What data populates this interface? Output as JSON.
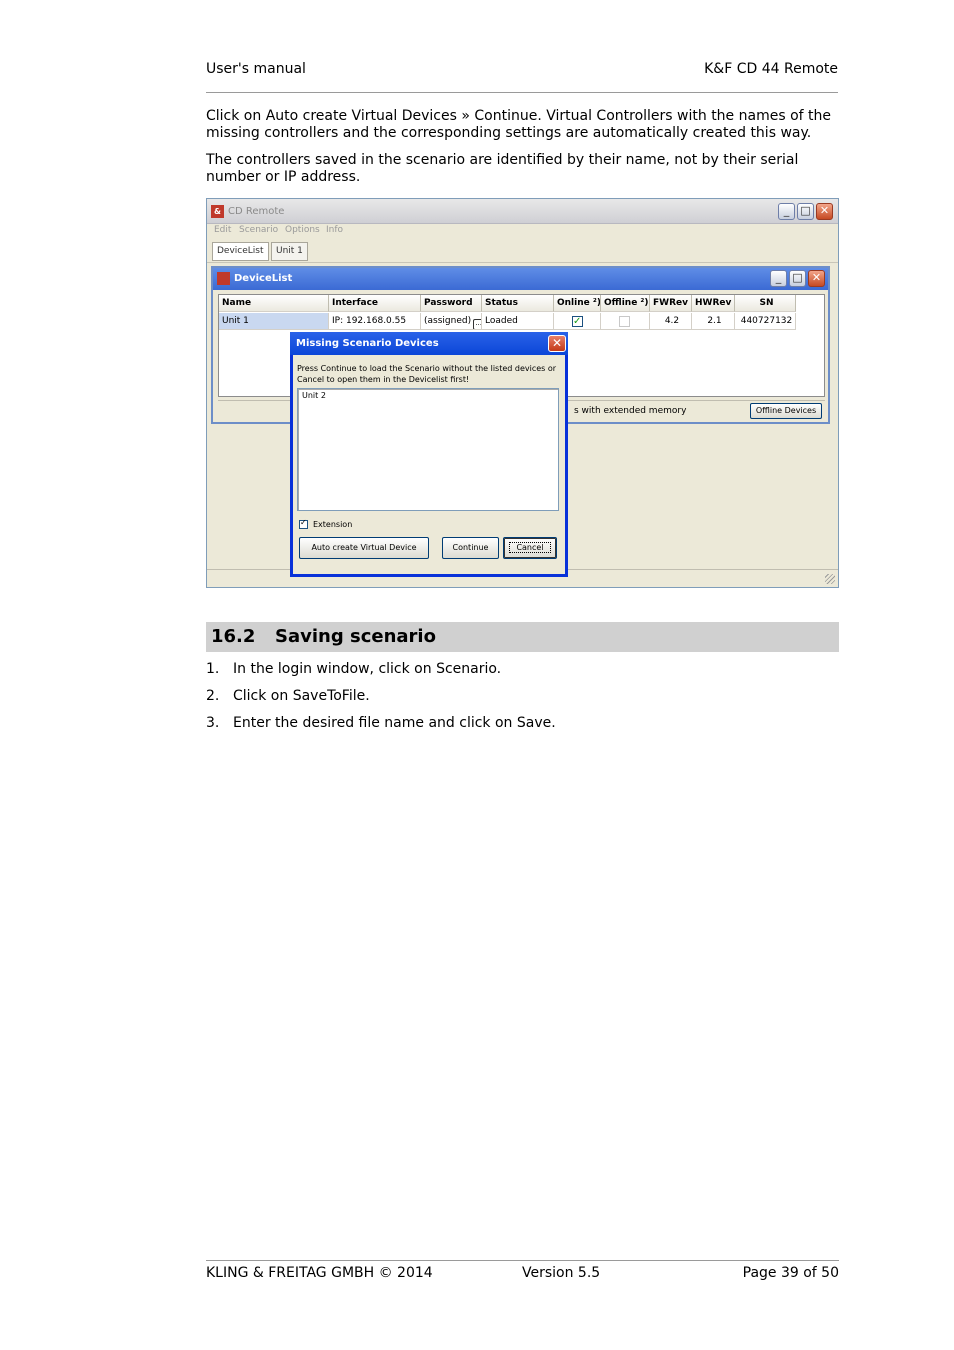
{
  "header": {
    "left": "User's manual",
    "right": "K&F CD  44 Remote"
  },
  "intro": {
    "p1": "Click on Auto create Virtual Devices » Continue. Virtual Controllers with the names of the missing controllers and the corresponding settings are automatically created this way.",
    "p2": "The controllers saved in the scenario are identified by their name, not by their serial number or IP address."
  },
  "app": {
    "app_icon": "&",
    "title": "CD Remote",
    "menu": [
      "Edit",
      "Scenario",
      "Options",
      "Info"
    ],
    "tabs": [
      "DeviceList",
      "Unit 1"
    ],
    "devicelist": {
      "title": "DeviceList",
      "columns": [
        "Name",
        "Interface",
        "Password",
        "Status",
        "Online ²)",
        "Offline ²)",
        "FWRev",
        "HWRev",
        "SN"
      ],
      "row": {
        "name": "Unit 1",
        "interface": "IP: 192.168.0.55",
        "password": "(assigned)",
        "password_btn": "...",
        "status": "Loaded",
        "online": true,
        "offline": false,
        "fwrev": "4.2",
        "hwrev": "2.1",
        "sn": "440727132"
      },
      "status_text": "s with extended memory",
      "offline_button": "Offline Devices"
    },
    "dialog": {
      "title": "Missing Scenario Devices",
      "message": "Press Continue to load the Scenario without the listed devices or Cancel to open them in the Devicelist first!",
      "items": [
        "Unit 2"
      ],
      "extension_label": "Extension",
      "extension_checked": true,
      "btn_auto": "Auto create Virtual Device",
      "btn_continue": "Continue",
      "btn_cancel": "Cancel"
    }
  },
  "section": {
    "number": "16.2",
    "title": "Saving scenario"
  },
  "steps": [
    {
      "n": "1.",
      "text": "In the login window, click on Scenario."
    },
    {
      "n": "2.",
      "text": "Click on SaveToFile."
    },
    {
      "n": "3.",
      "text": "Enter the desired file name and click on Save."
    }
  ],
  "footer": {
    "left": "KLING & FREITAG GMBH © 2014",
    "center": "Version 5.5",
    "right": "Page 39 of 50"
  }
}
